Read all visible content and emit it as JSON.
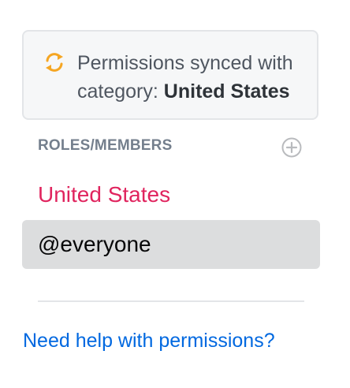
{
  "sync_notice": {
    "prefix": "Permissions synced with category:",
    "category": "United States",
    "icon": "sync-icon",
    "icon_color": "#f5a623"
  },
  "roles_section": {
    "header": "ROLES/MEMBERS",
    "add_icon": "plus-circle-icon",
    "items": [
      {
        "label": "United States",
        "color": "#e0245e",
        "selected": false
      },
      {
        "label": "@everyone",
        "color": "#060607",
        "selected": true
      }
    ]
  },
  "help": {
    "label": "Need help with permissions?",
    "color": "#0068e0"
  }
}
